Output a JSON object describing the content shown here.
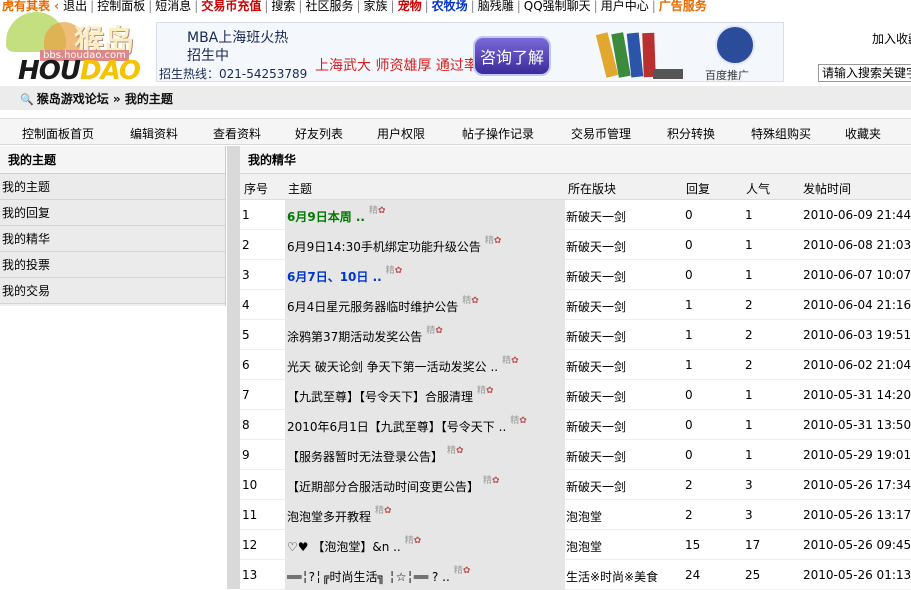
{
  "topbar": {
    "links": [
      {
        "label": "虎有其表 ‹",
        "style": "orange"
      },
      {
        "label": "退出",
        "style": ""
      },
      {
        "label": "控制面板",
        "style": ""
      },
      {
        "label": "短消息",
        "style": ""
      },
      {
        "label": "交易币充值",
        "style": "red"
      },
      {
        "label": "搜索",
        "style": ""
      },
      {
        "label": "社区服务",
        "style": ""
      },
      {
        "label": "家族",
        "style": ""
      },
      {
        "label": "宠物",
        "style": "red"
      },
      {
        "label": "农牧场",
        "style": "blue"
      },
      {
        "label": "脑残雕",
        "style": ""
      },
      {
        "label": "QQ强制聊天",
        "style": ""
      },
      {
        "label": "用户中心",
        "style": ""
      },
      {
        "label": "广告服务",
        "style": "orange"
      }
    ]
  },
  "logo": {
    "cn": "猴岛",
    "url": "bbs.houdao.com",
    "en_a": "HOU",
    "en_b": "DAO"
  },
  "ad": {
    "line1": "MBA上海班火热",
    "line2": "招生中",
    "line3": "招生热线：021-54253789",
    "slogan": "上海武大 师资雄厚 通过率高",
    "button": "咨询了解",
    "baidu": "百度推广"
  },
  "header": {
    "join_fav": "加入收藏",
    "search_placeholder": "请输入搜索关键字"
  },
  "breadcrumb": {
    "forum": "猴岛游戏论坛",
    "sep": "»",
    "current": "我的主题"
  },
  "nav": [
    "控制面板首页",
    "编辑资料",
    "查看资料",
    "好友列表",
    "用户权限",
    "帖子操作记录",
    "交易币管理",
    "积分转换",
    "特殊组购买",
    "收藏夹"
  ],
  "sidebar": {
    "title": "我的主题",
    "items": [
      "我的主题",
      "我的回复",
      "我的精华",
      "我的投票",
      "我的交易"
    ]
  },
  "main": {
    "title": "我的精华",
    "headers": {
      "num": "序号",
      "subject": "主题",
      "board": "所在版块",
      "replies": "回复",
      "views": "人气",
      "time": "发帖时间"
    },
    "hot_label": "精",
    "rows": [
      {
        "num": "1",
        "subject": "6月9日本周 ..",
        "style": "green",
        "board": "新破天一剑",
        "replies": "0",
        "views": "1",
        "time": "2010-06-09 21:44"
      },
      {
        "num": "2",
        "subject": "6月9日14:30手机绑定功能升级公告",
        "style": "",
        "board": "新破天一剑",
        "replies": "0",
        "views": "1",
        "time": "2010-06-08 21:03"
      },
      {
        "num": "3",
        "subject": "6月7日、10日 ..",
        "style": "bluebold",
        "board": "新破天一剑",
        "replies": "0",
        "views": "1",
        "time": "2010-06-07 10:07"
      },
      {
        "num": "4",
        "subject": "6月4日星元服务器临时维护公告",
        "style": "",
        "board": "新破天一剑",
        "replies": "1",
        "views": "2",
        "time": "2010-06-04 21:16"
      },
      {
        "num": "5",
        "subject": "涂鸦第37期活动发奖公告",
        "style": "",
        "board": "新破天一剑",
        "replies": "1",
        "views": "2",
        "time": "2010-06-03 19:51"
      },
      {
        "num": "6",
        "subject": "光天 破天论剑 争天下第一活动发奖公 ..",
        "style": "",
        "board": "新破天一剑",
        "replies": "1",
        "views": "2",
        "time": "2010-06-02 21:04"
      },
      {
        "num": "7",
        "subject": "【九武至尊】【号令天下】合服清理",
        "style": "",
        "board": "新破天一剑",
        "replies": "0",
        "views": "1",
        "time": "2010-05-31 14:20"
      },
      {
        "num": "8",
        "subject": "2010年6月1日【九武至尊】【号令天下 ..",
        "style": "",
        "board": "新破天一剑",
        "replies": "0",
        "views": "1",
        "time": "2010-05-31 13:50"
      },
      {
        "num": "9",
        "subject": "【服务器暂时无法登录公告】",
        "style": "",
        "board": "新破天一剑",
        "replies": "0",
        "views": "1",
        "time": "2010-05-29 19:01"
      },
      {
        "num": "10",
        "subject": "【近期部分合服活动时间变更公告】",
        "style": "",
        "board": "新破天一剑",
        "replies": "2",
        "views": "3",
        "time": "2010-05-26 17:34"
      },
      {
        "num": "11",
        "subject": "泡泡堂多开教程",
        "style": "",
        "board": "泡泡堂",
        "replies": "2",
        "views": "3",
        "time": "2010-05-26 13:17"
      },
      {
        "num": "12",
        "subject": "♡♥ 【泡泡堂】&n ..",
        "style": "",
        "board": "泡泡堂",
        "replies": "15",
        "views": "17",
        "time": "2010-05-26 09:45"
      },
      {
        "num": "13",
        "subject": "══╎?╎╔时尚生活╗ ╎☆╎══ ? ..",
        "style": "",
        "board": "生活※时尚※美食",
        "replies": "24",
        "views": "25",
        "time": "2010-05-26 01:13"
      }
    ]
  },
  "colors": {
    "accent_red": "#cc0000",
    "accent_blue": "#0033cc",
    "accent_green": "#007a00",
    "sidebar_bg": "#ebebeb"
  }
}
